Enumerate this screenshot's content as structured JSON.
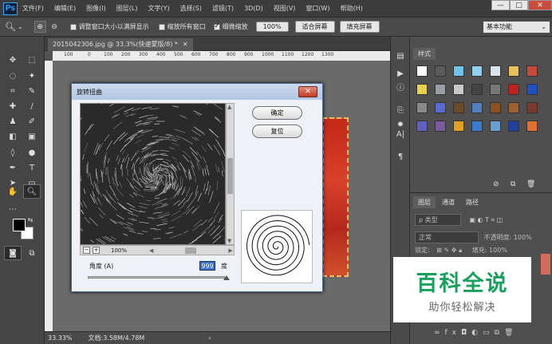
{
  "app": {
    "logo": "Ps"
  },
  "menu": [
    "文件(F)",
    "编辑(E)",
    "图像(I)",
    "图层(L)",
    "文字(Y)",
    "选择(S)",
    "滤镜(T)",
    "3D(D)",
    "视图(V)",
    "窗口(W)",
    "帮助(H)"
  ],
  "window_controls": {
    "minimize": "—",
    "restore": "□",
    "close": "✕"
  },
  "options": {
    "resize_windows": "调整窗口大小以满屏显示",
    "zoom_all": "缩放所有窗口",
    "scrubby_zoom": "细微缩放",
    "zoom_value": "100%",
    "fit_screen": "适合屏幕",
    "fill_screen": "填充屏幕",
    "workspace": "基本功能"
  },
  "document": {
    "tab": "2015042306.jpg @ 33.3%(快速蒙版/8) *",
    "ruler_ticks": [
      "100",
      "0",
      "100",
      "200",
      "300",
      "400",
      "500",
      "600",
      "700",
      "800",
      "900",
      "1000",
      "1100",
      "1200",
      "1300"
    ],
    "zoom": "33.33%",
    "doc_info": "文档:3.58M/4.78M"
  },
  "dialog": {
    "title": "旋转扭曲",
    "close": "✕",
    "ok": "确定",
    "reset": "复位",
    "preview_zoom": "100%",
    "angle_label": "角度 (A)",
    "angle_value": "999",
    "angle_unit": "度"
  },
  "styles_panel": {
    "tab": "样式"
  },
  "layers_panel": {
    "tabs": [
      "图层",
      "通道",
      "路径"
    ],
    "kind_filter": "ρ 类型",
    "blend_mode": "正常",
    "opacity_label": "不透明度:",
    "opacity_value": "100%",
    "lock_label": "锁定:",
    "fill_label": "填充:",
    "fill_value": "100%"
  },
  "watermark": {
    "title": "百科全说",
    "subtitle": "助你轻松解决"
  }
}
